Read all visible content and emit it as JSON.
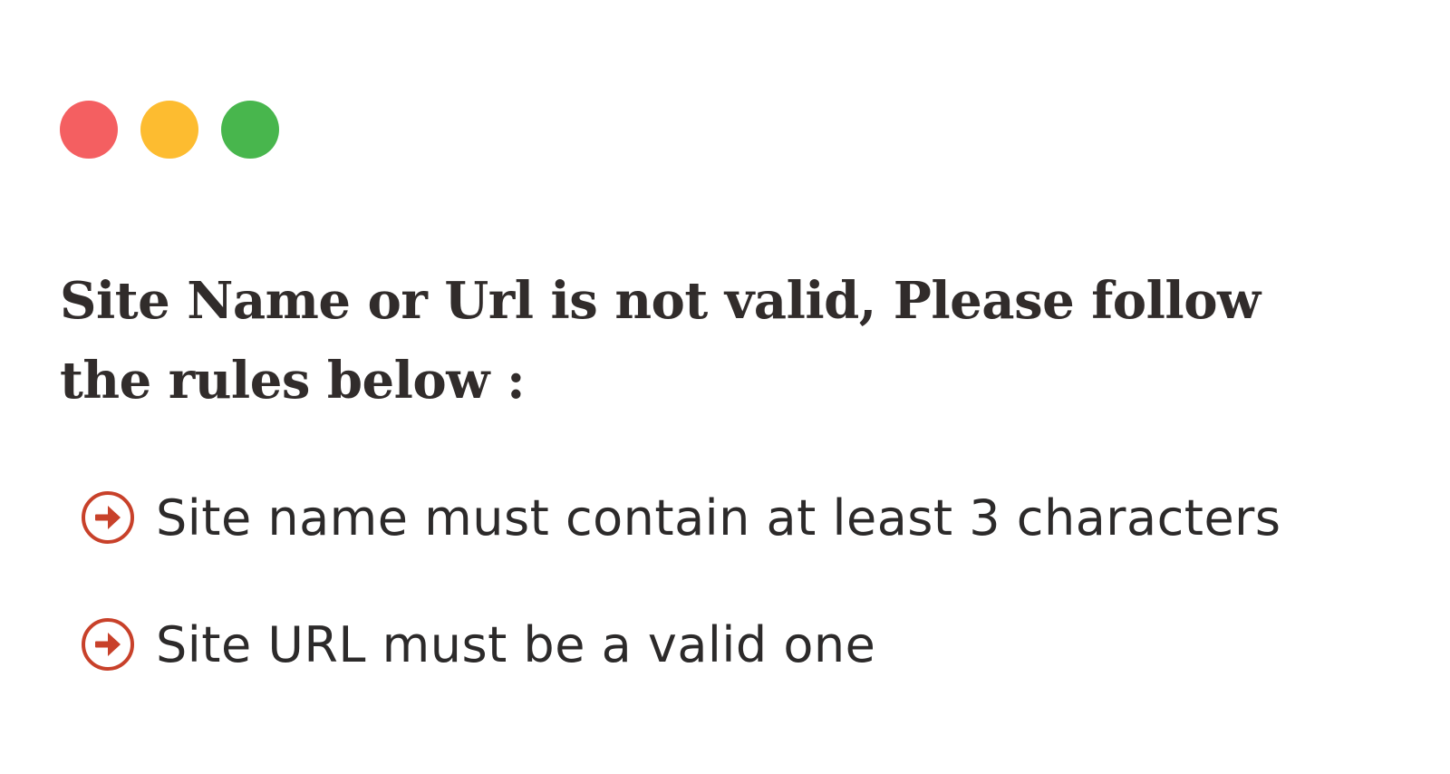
{
  "window": {
    "controls": [
      {
        "name": "close",
        "color": "#f45f61"
      },
      {
        "name": "minimize",
        "color": "#fdbc30"
      },
      {
        "name": "maximize",
        "color": "#48b64d"
      }
    ]
  },
  "error": {
    "message": "Site Name or Url is not valid, Please follow the rules below :"
  },
  "rules": {
    "icon": "arrow-right-circle-icon",
    "icon_color": "#c8412a",
    "items": [
      {
        "text": "Site name must contain at least 3 characters"
      },
      {
        "text": "Site URL must be a valid one"
      }
    ]
  }
}
